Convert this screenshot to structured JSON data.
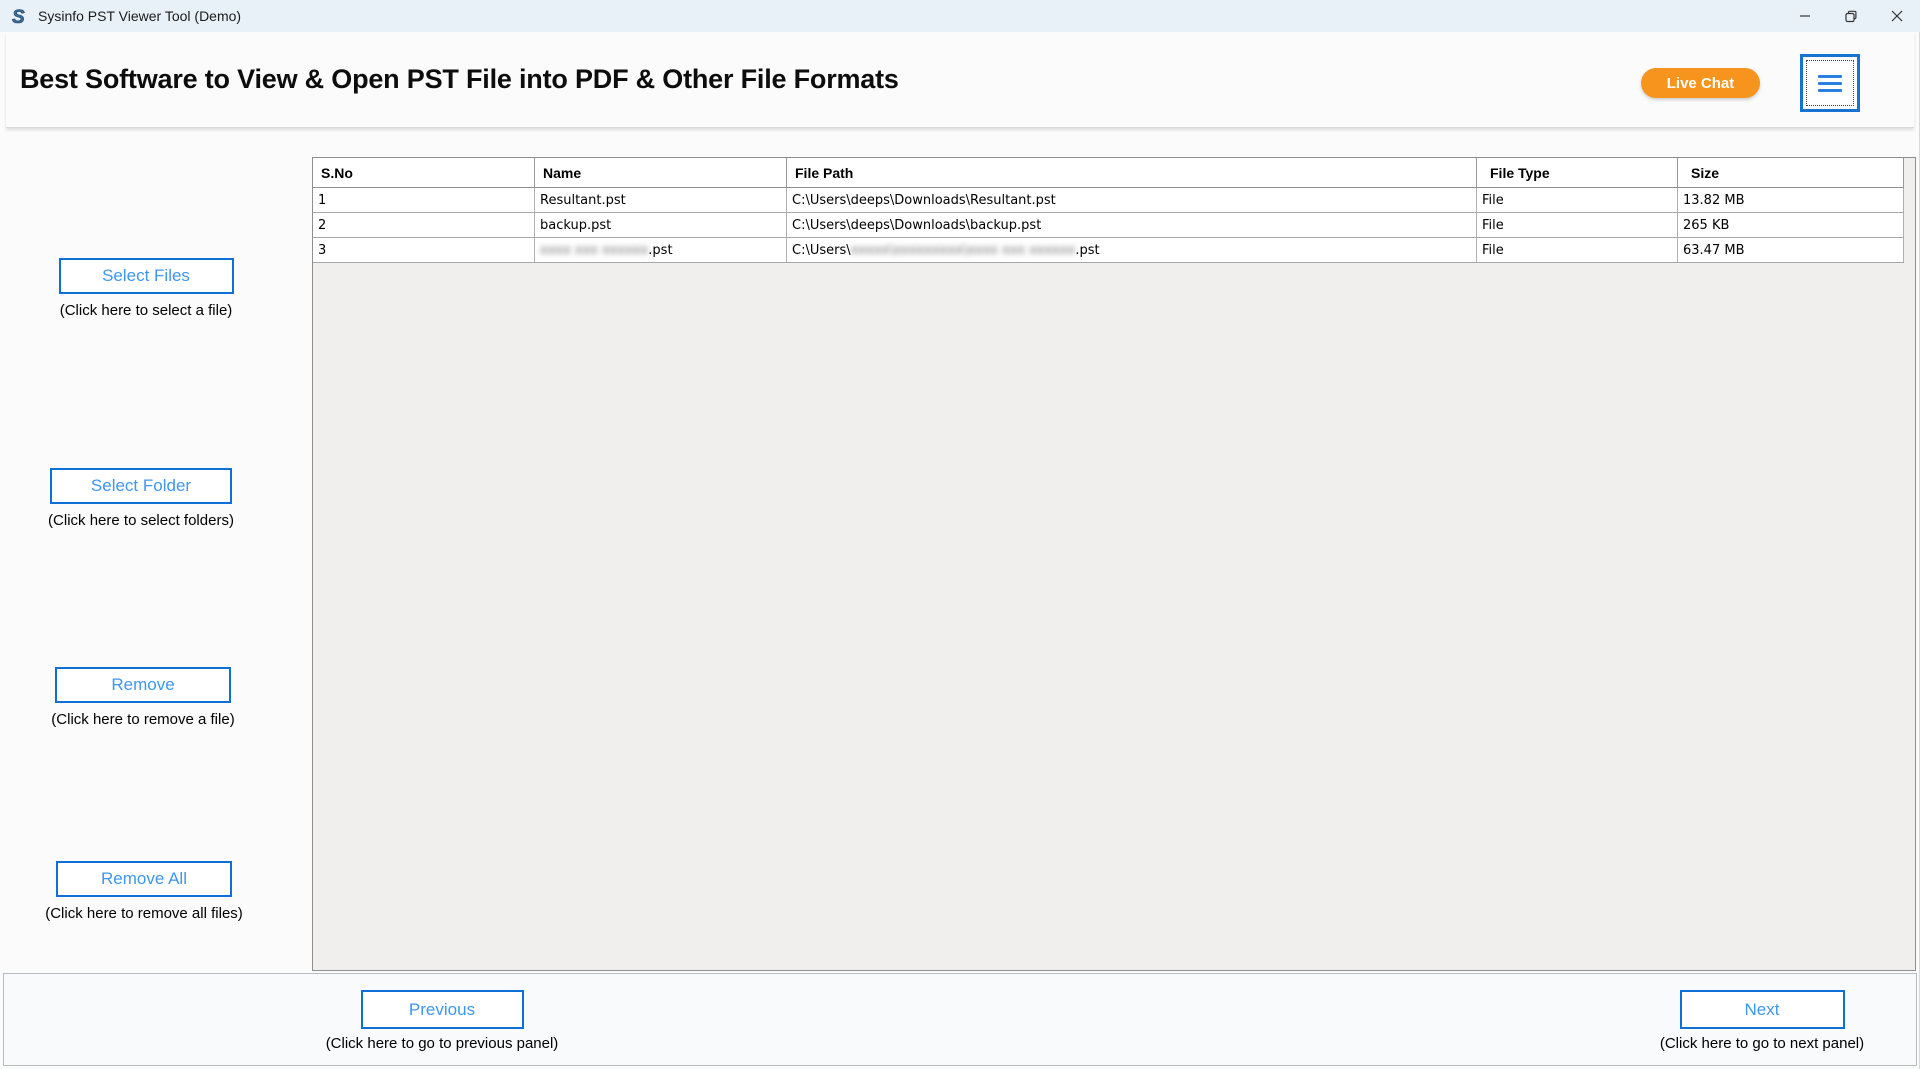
{
  "window": {
    "title": "Sysinfo PST Viewer Tool (Demo)",
    "icons": {
      "app": "sysinfo-logo-icon",
      "minimize": "minimize-icon",
      "restore": "restore-icon",
      "close": "close-icon"
    }
  },
  "header": {
    "headline": "Best Software to View & Open PST File into PDF & Other File Formats",
    "live_chat_label": "Live Chat",
    "menu_icon": "hamburger-icon"
  },
  "sidebar": {
    "buttons": [
      {
        "label": "Select Files",
        "caption": "(Click here to select a file)"
      },
      {
        "label": "Select Folder",
        "caption": "(Click here to select folders)"
      },
      {
        "label": "Remove",
        "caption": "(Click here to remove a file)"
      },
      {
        "label": "Remove All",
        "caption": "(Click here to remove all files)"
      }
    ]
  },
  "table": {
    "columns": [
      "S.No",
      "Name",
      "File Path",
      "File Type",
      "Size"
    ],
    "rows": [
      {
        "sno": "1",
        "name": [
          {
            "text": "Resultant.pst"
          }
        ],
        "path": [
          {
            "text": "C:\\Users\\deeps\\Downloads\\Resultant.pst"
          }
        ],
        "type": "File",
        "size": "13.82 MB"
      },
      {
        "sno": "2",
        "name": [
          {
            "text": "backup.pst"
          }
        ],
        "path": [
          {
            "text": "C:\\Users\\deeps\\Downloads\\backup.pst"
          }
        ],
        "type": "File",
        "size": "265 KB"
      },
      {
        "sno": "3",
        "name": [
          {
            "text": "xxxx xxx xxxxxx",
            "redacted": true
          },
          {
            "text": ".pst"
          }
        ],
        "path": [
          {
            "text": "C:\\Users\\"
          },
          {
            "text": "xxxxx\\xxxxxxxxx\\xxxx xxx xxxxxx",
            "redacted": true
          },
          {
            "text": ".pst"
          }
        ],
        "type": "File",
        "size": "63.47 MB"
      }
    ]
  },
  "footer": {
    "previous": {
      "label": "Previous",
      "caption": "(Click here to go to previous panel)"
    },
    "next": {
      "label": "Next",
      "caption": "(Click here to go to next panel)"
    }
  },
  "colors": {
    "accent_blue_border": "#0e6fd6",
    "button_text_blue": "#3e97f0",
    "live_chat_orange": "#f7941d",
    "titlebar_bg": "#e9f1f8",
    "table_empty_bg": "#f1efed"
  }
}
